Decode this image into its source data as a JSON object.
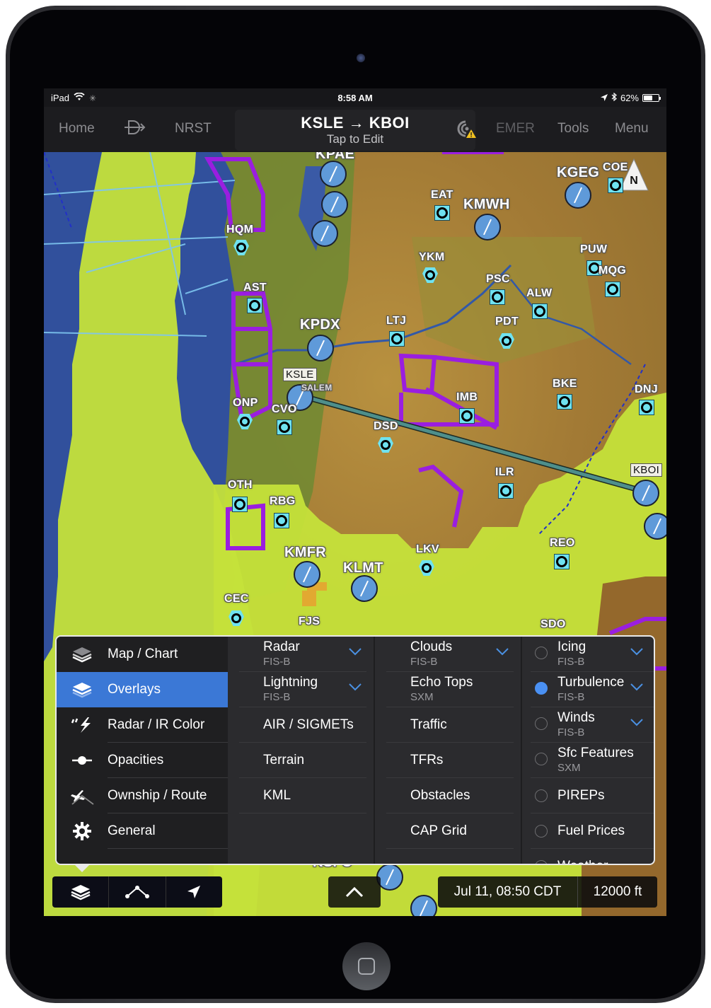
{
  "status_bar": {
    "device": "iPad",
    "time": "8:58 AM",
    "battery": "62%",
    "battery_level": 0.62
  },
  "toolbar": {
    "home": "Home",
    "direct_to_icon": "direct-to",
    "nrst": "NRST",
    "route_title": "KSLE → KBOI",
    "route_subtitle": "Tap to Edit",
    "emer": "EMER",
    "tools": "Tools",
    "menu": "Menu"
  },
  "map": {
    "north_label": "N",
    "airports_major": [
      {
        "id": "KPAE",
        "label": "KPAE"
      },
      {
        "id": "KGEG",
        "label": "KGEG"
      },
      {
        "id": "KMWH",
        "label": "KMWH"
      },
      {
        "id": "KPDX",
        "label": "KPDX"
      },
      {
        "id": "KSLE",
        "label": "KSLE"
      },
      {
        "id": "KBOI",
        "label": "KBOI"
      },
      {
        "id": "KMFR",
        "label": "KMFR"
      },
      {
        "id": "KLMT",
        "label": "KLMT"
      },
      {
        "id": "KSFO",
        "label": "KSFO"
      }
    ],
    "navaids": [
      "HQM",
      "AST",
      "EAT",
      "YKM",
      "PSC",
      "ALW",
      "PUW",
      "MQG",
      "COE",
      "LTJ",
      "PDT",
      "BKE",
      "DNJ",
      "ONP",
      "CVO",
      "DSD",
      "IMB",
      "ILR",
      "OTH",
      "RBG",
      "LKV",
      "REO",
      "CEC",
      "FJS",
      "SDO"
    ],
    "city_label": "SALEM"
  },
  "overlay_panel": {
    "left_menu": [
      {
        "label": "Map / Chart",
        "icon": "map-layers-icon",
        "active": false
      },
      {
        "label": "Overlays",
        "icon": "overlays-icon",
        "active": true
      },
      {
        "label": "Radar / IR Color",
        "icon": "radar-lightning-icon",
        "active": false
      },
      {
        "label": "Opacities",
        "icon": "slider-icon",
        "active": false
      },
      {
        "label": "Ownship / Route",
        "icon": "airplane-route-icon",
        "active": false
      },
      {
        "label": "General",
        "icon": "gear-icon",
        "active": false
      }
    ],
    "column1": [
      {
        "label": "Radar",
        "source": "FIS-B",
        "expandable": true
      },
      {
        "label": "Lightning",
        "source": "FIS-B",
        "expandable": true
      },
      {
        "label": "AIR / SIGMETs",
        "source": "",
        "expandable": false
      },
      {
        "label": "Terrain",
        "source": "",
        "expandable": false
      },
      {
        "label": "KML",
        "source": "",
        "expandable": false
      }
    ],
    "column2": [
      {
        "label": "Clouds",
        "source": "FIS-B",
        "expandable": true
      },
      {
        "label": "Echo Tops",
        "source": "SXM",
        "expandable": false
      },
      {
        "label": "Traffic",
        "source": "",
        "expandable": false
      },
      {
        "label": "TFRs",
        "source": "",
        "expandable": false
      },
      {
        "label": "Obstacles",
        "source": "",
        "expandable": false
      },
      {
        "label": "CAP Grid",
        "source": "",
        "expandable": false
      }
    ],
    "column3": [
      {
        "label": "Icing",
        "source": "FIS-B",
        "expandable": true,
        "selected": false
      },
      {
        "label": "Turbulence",
        "source": "FIS-B",
        "expandable": true,
        "selected": true
      },
      {
        "label": "Winds",
        "source": "FIS-B",
        "expandable": true,
        "selected": false
      },
      {
        "label": "Sfc Features",
        "source": "SXM",
        "expandable": false,
        "selected": false
      },
      {
        "label": "PIREPs",
        "source": "",
        "expandable": false,
        "selected": false
      },
      {
        "label": "Fuel Prices",
        "source": "",
        "expandable": false,
        "selected": false
      },
      {
        "label": "Weather",
        "source": "",
        "expandable": false,
        "selected": false
      }
    ]
  },
  "bottom_bar": {
    "timestamp": "Jul 11, 08:50 CDT",
    "altitude": "12000 ft"
  },
  "colors": {
    "accent": "#3b78d6",
    "turbulence_overlay": "#c8e62e",
    "airspace_purple": "#9a1ee0",
    "water": "#2f4f9e",
    "route_line": "#4e8f8b"
  }
}
